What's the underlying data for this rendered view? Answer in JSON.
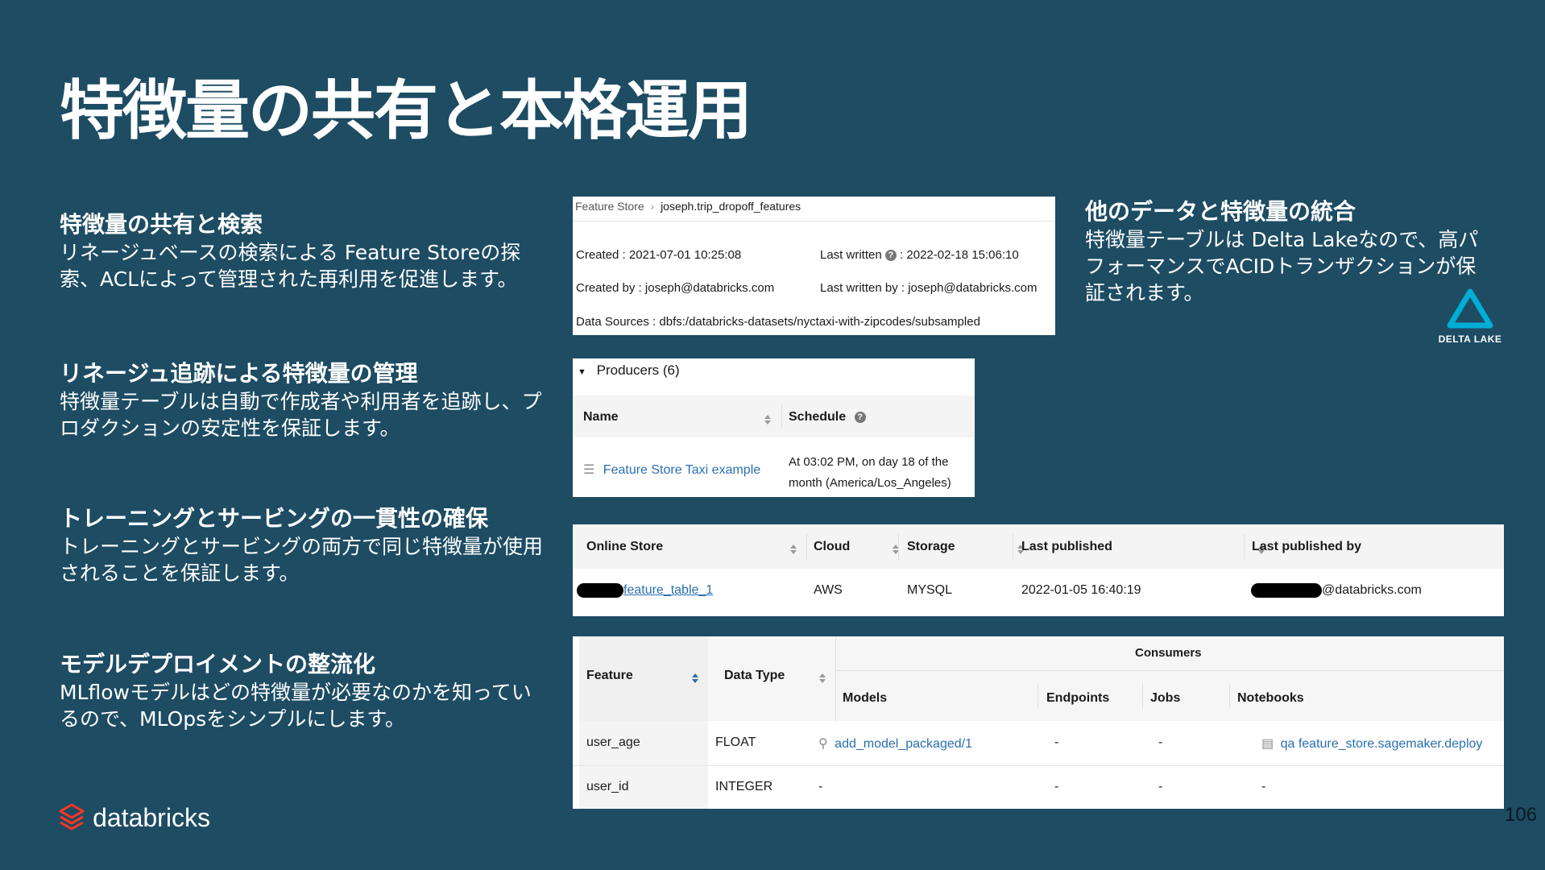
{
  "slide": {
    "title": "特徴量の共有と本格運用",
    "page_number": "106",
    "brand": "databricks"
  },
  "left": [
    {
      "heading": "特徴量の共有と検索",
      "body": "リネージュベースの検索による Feature Storeの探索、ACLによって管理された再利用を促進します。"
    },
    {
      "heading": "リネージュ追跡による特徴量の管理",
      "body": "特徴量テーブルは自動で作成者や利用者を追跡し、プロダクションの安定性を保証します。"
    },
    {
      "heading": "トレーニングとサービングの一貫性の確保",
      "body": "トレーニングとサービングの両方で同じ特徴量が使用されることを保証します。"
    },
    {
      "heading": "モデルデプロイメントの整流化",
      "body": "MLflowモデルはどの特徴量が必要なのかを知っているので、MLOpsをシンプルにします。"
    }
  ],
  "right": {
    "heading": "他のデータと特徴量の統合",
    "body": "特徴量テーブルは Delta Lakeなので、高パフォーマンスでACIDトランザクションが保証されます。",
    "logo_text": "DELTA LAKE"
  },
  "feature_panel": {
    "breadcrumb_root": "Feature Store",
    "breadcrumb_current": "joseph.trip_dropoff_features",
    "created_label": "Created :",
    "created_value": "2021-07-01 10:25:08",
    "last_written_label": "Last written",
    "last_written_value": ": 2022-02-18 15:06:10",
    "created_by_label": "Created by :",
    "created_by_value": "joseph@databricks.com",
    "last_written_by_label": "Last written by :",
    "last_written_by_value": "joseph@databricks.com",
    "data_sources_label": "Data Sources :",
    "data_sources_value": "dbfs:/databricks-datasets/nyctaxi-with-zipcodes/subsampled"
  },
  "producers": {
    "title": "Producers (6)",
    "col_name": "Name",
    "col_schedule": "Schedule",
    "row_name": "Feature Store Taxi example",
    "row_schedule_1": "At 03:02 PM, on day 18 of the",
    "row_schedule_2": "month (America/Los_Angeles)"
  },
  "online_store": {
    "headers": [
      "Online Store",
      "Cloud",
      "Storage",
      "Last published",
      "Last published by"
    ],
    "row": {
      "store": "feature_table_1",
      "cloud": "AWS",
      "storage": "MYSQL",
      "last_published": "2022-01-05 16:40:19",
      "published_by": "@databricks.com"
    }
  },
  "features": {
    "col_feature": "Feature",
    "col_type": "Data Type",
    "consumers": "Consumers",
    "sub_models": "Models",
    "sub_endpoints": "Endpoints",
    "sub_jobs": "Jobs",
    "sub_notebooks": "Notebooks",
    "rows": [
      {
        "feature": "user_age",
        "type": "FLOAT",
        "models": "add_model_packaged/1",
        "endpoints": "-",
        "jobs": "-",
        "notebooks": "qa feature_store.sagemaker.deploy"
      },
      {
        "feature": "user_id",
        "type": "INTEGER",
        "models": "-",
        "endpoints": "-",
        "jobs": "-",
        "notebooks": "-"
      }
    ]
  },
  "colors": {
    "background": "#1d4c63",
    "link": "#2a6fb0",
    "brand": "#ff3621",
    "delta": "#00add4"
  }
}
